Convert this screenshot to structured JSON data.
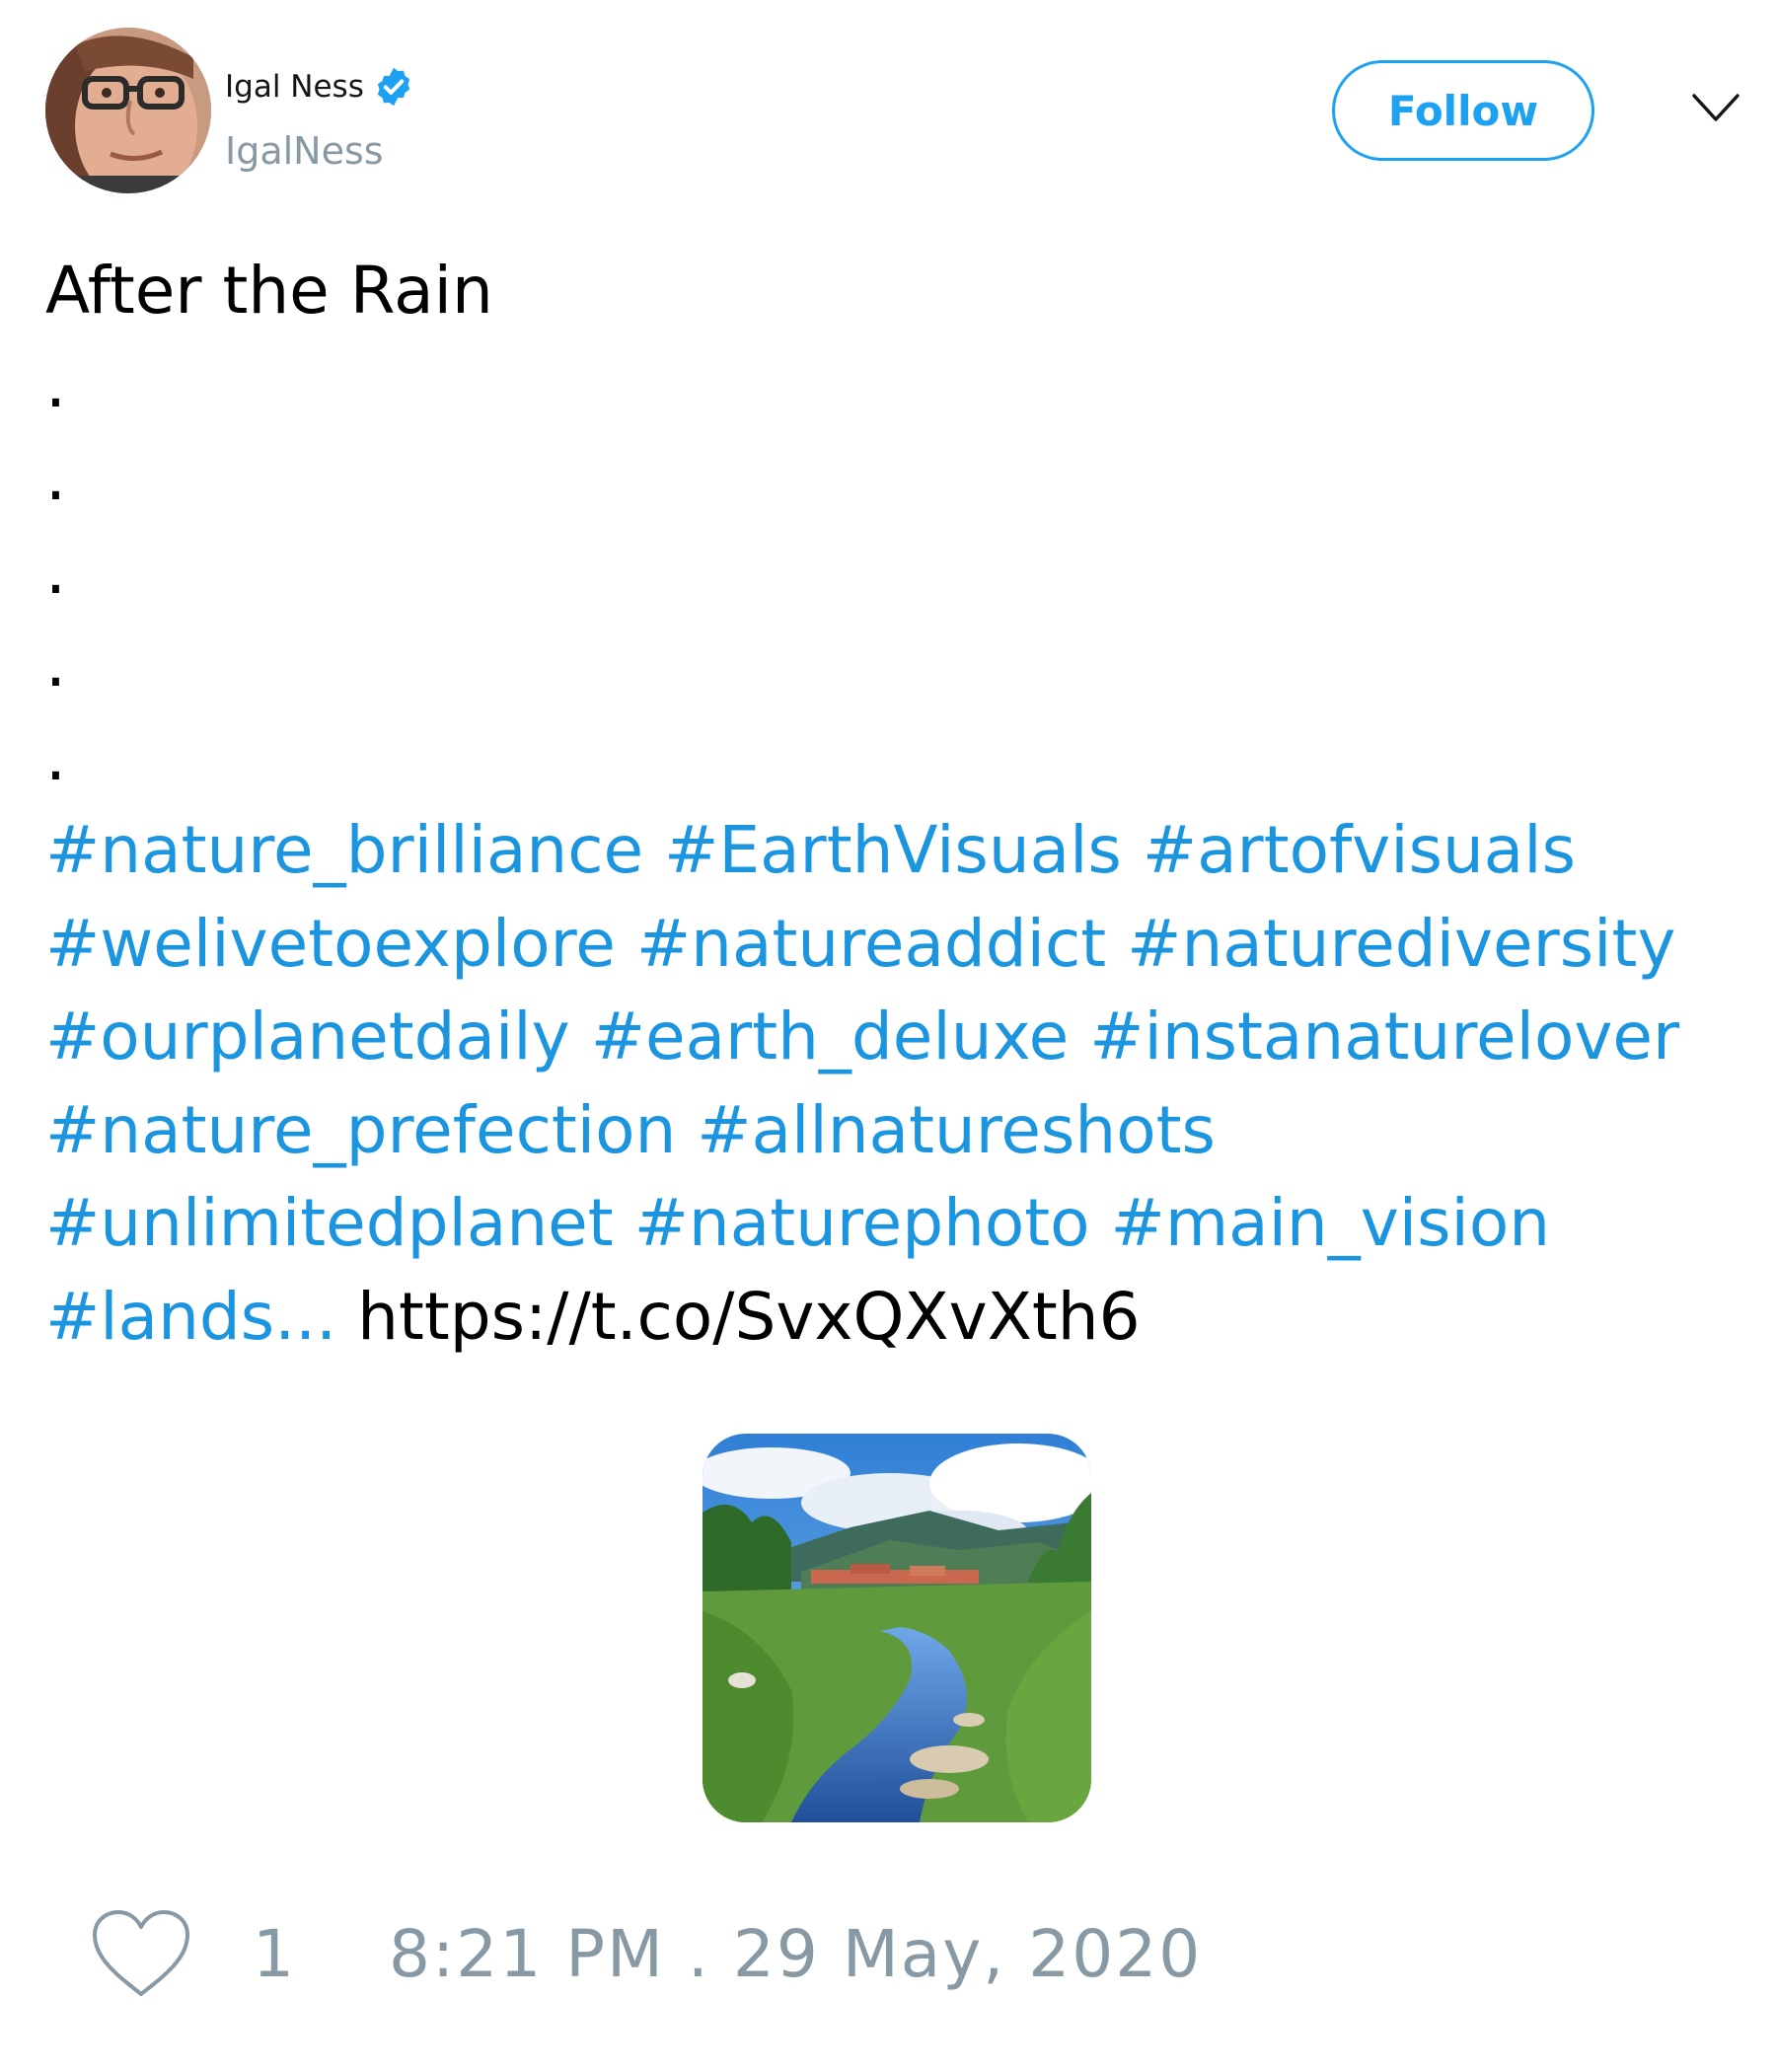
{
  "author": {
    "display_name": "Igal Ness",
    "handle": "IgalNess",
    "verified": true,
    "verified_icon": "verified-badge-icon",
    "avatar_icon": "user-avatar"
  },
  "header": {
    "follow_label": "Follow",
    "menu_icon": "chevron-down-icon"
  },
  "tweet": {
    "title": "After the Rain",
    "dots": [
      ".",
      ".",
      ".",
      ".",
      "."
    ],
    "hashtag_lines": [
      [
        "#nature_brilliance",
        "#EarthVisuals",
        "#artofvisuals"
      ],
      [
        "#welivetoexplore",
        "#natureaddict",
        "#naturediversity"
      ],
      [
        "#ourplanetdaily",
        "#earth_deluxe",
        "#instanaturelover"
      ],
      [
        "#nature_prefection",
        "#allnatureshots"
      ],
      [
        "#unlimitedplanet",
        "#naturephoto",
        "#main_vision"
      ]
    ],
    "last_hashtag": "#lands...",
    "link": "https://t.co/SvxQXvXth6",
    "media_icon": "landscape-photo"
  },
  "footer": {
    "like_icon": "heart-icon",
    "like_count": "1",
    "timestamp": "8:21 PM . 29 May, 2020"
  },
  "colors": {
    "accent": "#1da1f2",
    "hashtag": "#1b95e0",
    "muted": "#8899a6",
    "text": "#000000"
  }
}
